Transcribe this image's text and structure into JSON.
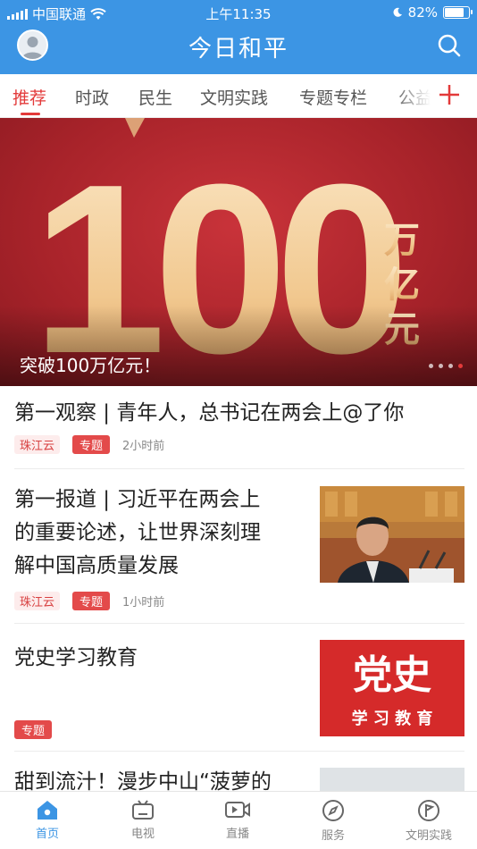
{
  "status_bar": {
    "carrier": "中国联通",
    "time": "上午11:35",
    "battery_text": "82%",
    "battery_level": 0.82
  },
  "header": {
    "title": "今日和平"
  },
  "tabs": [
    {
      "label": "推荐",
      "active": true
    },
    {
      "label": "时政"
    },
    {
      "label": "民生"
    },
    {
      "label": "文明实践"
    },
    {
      "label": "专题专栏"
    },
    {
      "label": "公益"
    }
  ],
  "banner": {
    "big_number": "100",
    "unit": [
      "万",
      "亿",
      "元"
    ],
    "caption": "突破100万亿元！",
    "slide_count": 4,
    "active_slide": 4
  },
  "articles": [
    {
      "title": "第一观察 | 青年人，总书记在两会上@了你",
      "source": "珠江云",
      "tag": "专题",
      "time": "2小时前"
    },
    {
      "title_lines": [
        "第一报道 | 习近平在两会上",
        "的重要论述，让世界深刻理",
        "解中国高质量发展"
      ],
      "source": "珠江云",
      "tag": "专题",
      "time": "1小时前"
    },
    {
      "title": "党史学习教育",
      "tag": "专题",
      "thumb_title": "党史",
      "thumb_subtitle": "学 习 教 育"
    },
    {
      "title": "甜到流汁！漫步中山“菠萝的"
    }
  ],
  "bottom_nav": [
    {
      "label": "首页",
      "icon": "home-icon",
      "active": true
    },
    {
      "label": "电视",
      "icon": "tv-icon"
    },
    {
      "label": "直播",
      "icon": "live-icon"
    },
    {
      "label": "服务",
      "icon": "compass-icon"
    },
    {
      "label": "文明实践",
      "icon": "flag-circle-icon"
    }
  ],
  "colors": {
    "brand_blue": "#3c95e4",
    "accent_red": "#e33a3a"
  }
}
